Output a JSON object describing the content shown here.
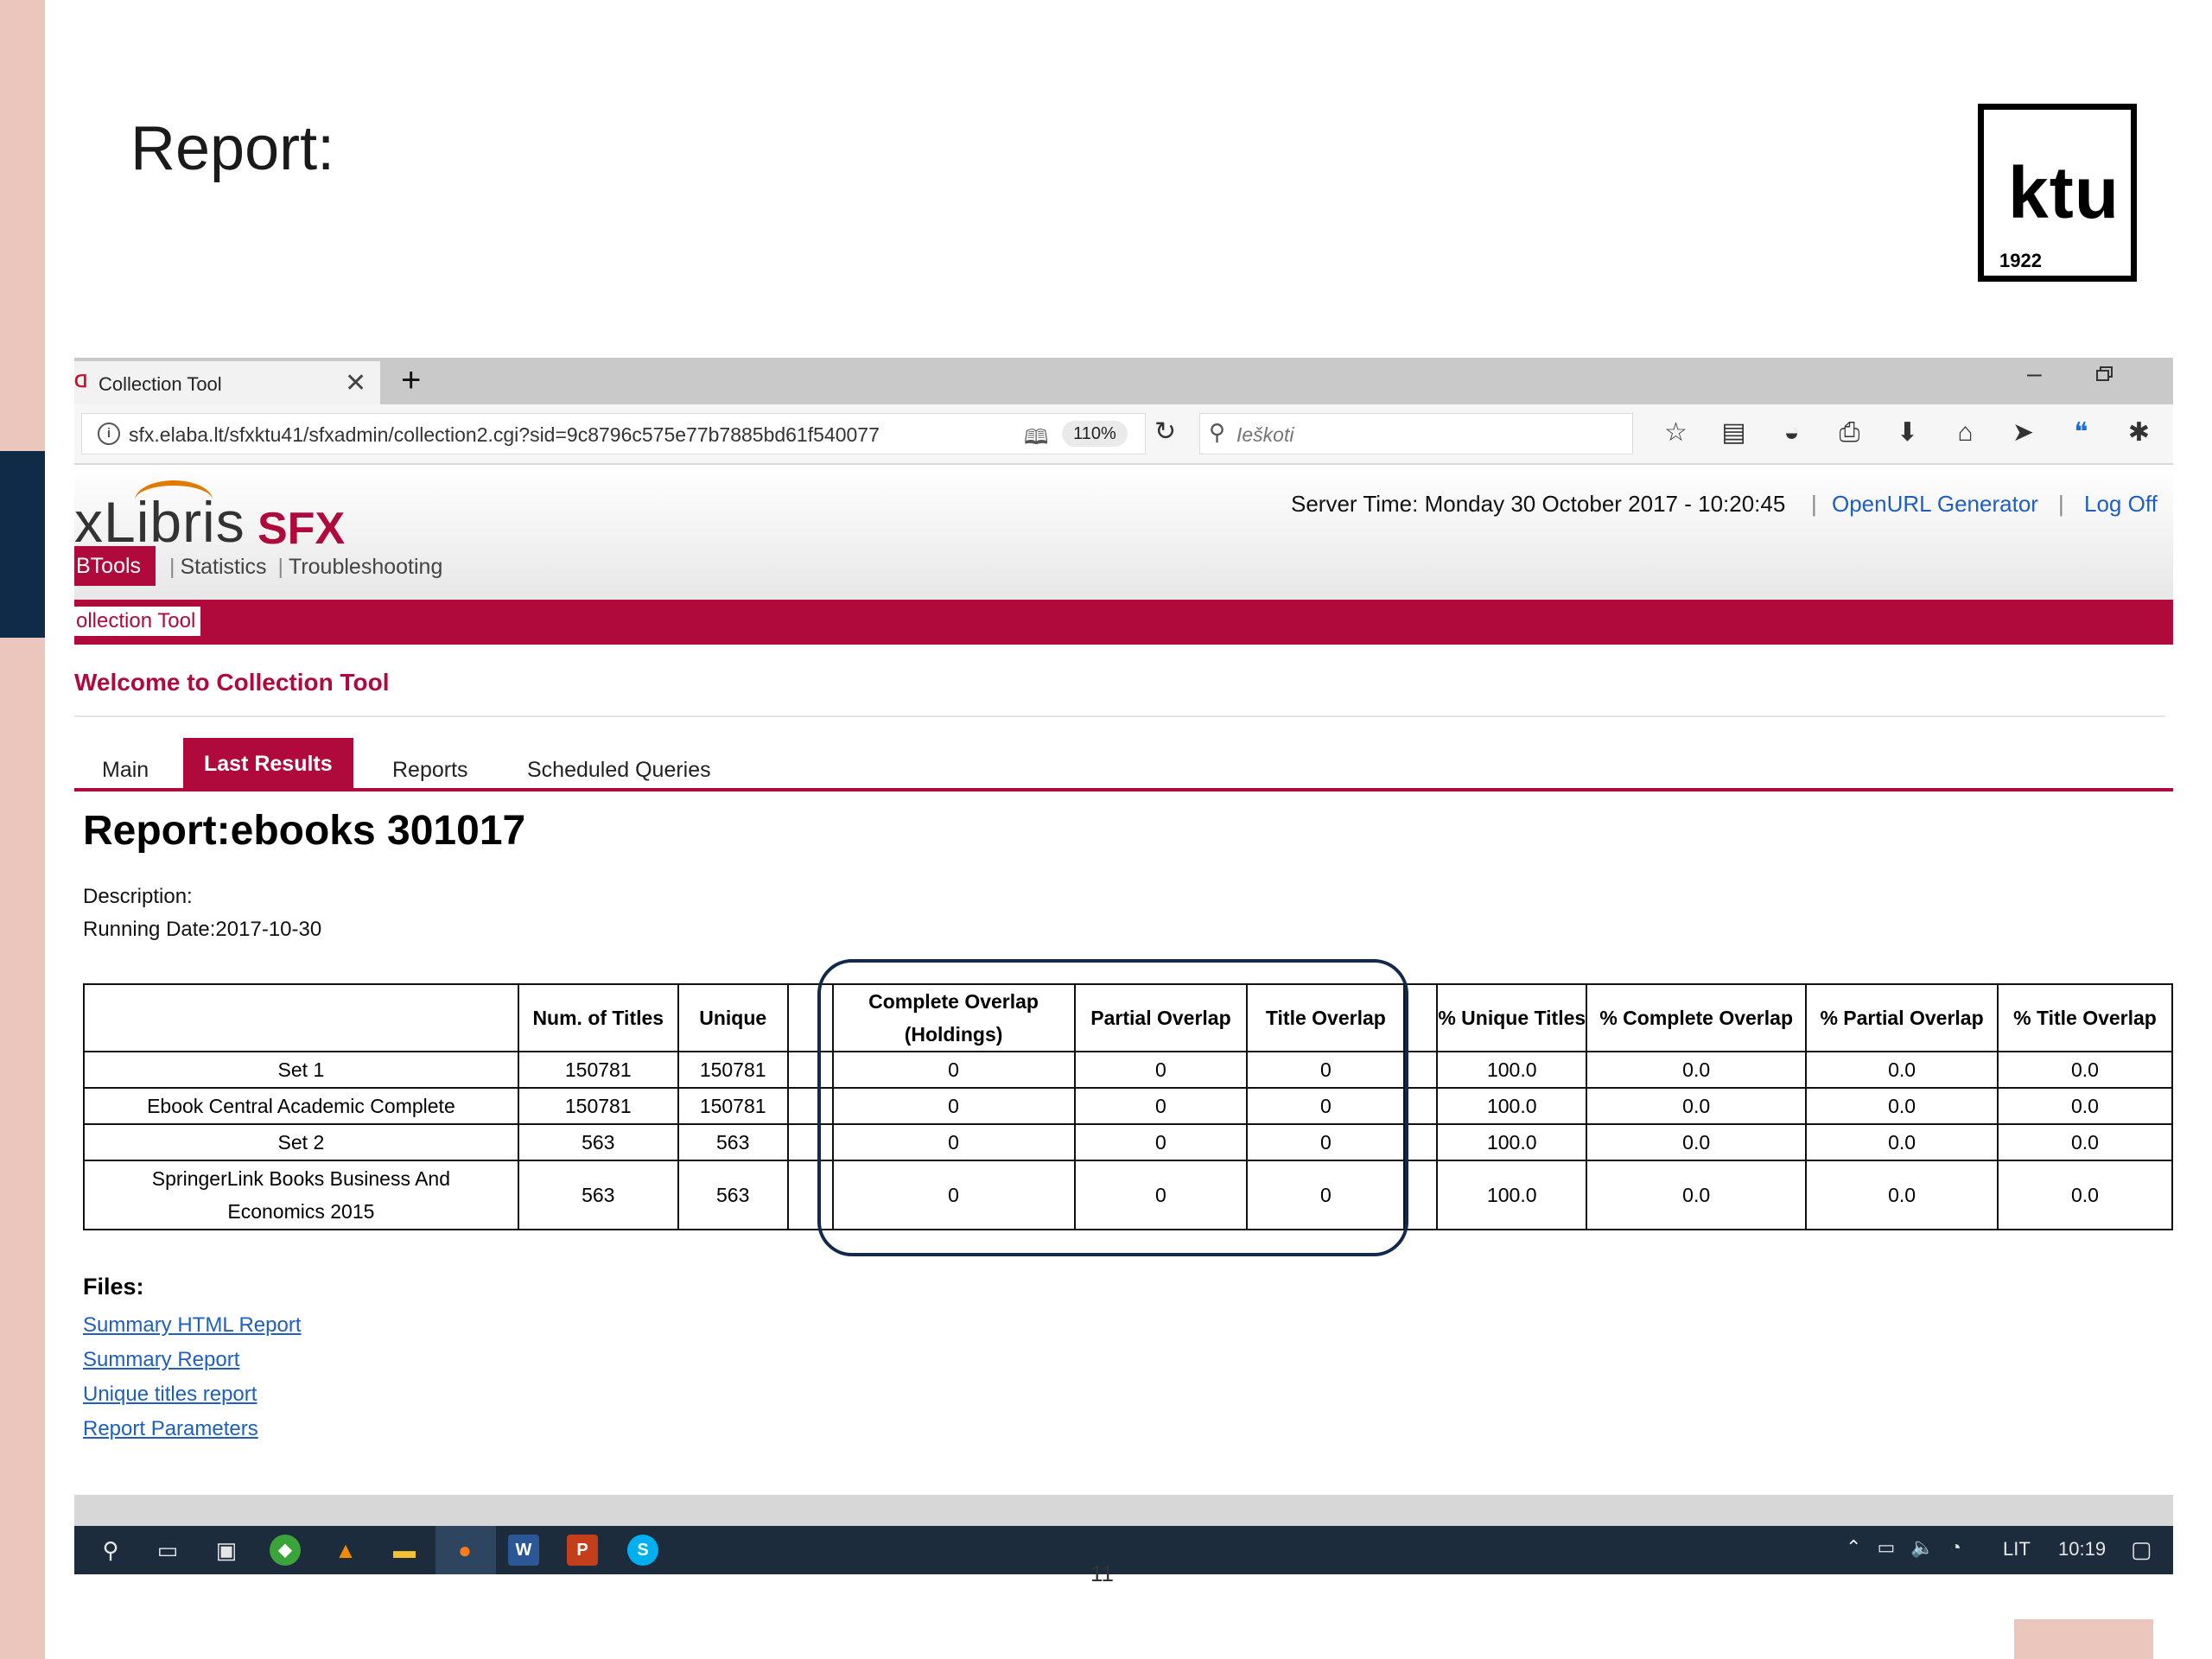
{
  "slide": {
    "title": "Report:",
    "logo_text": "ktu",
    "logo_year": "1922",
    "page_number": "11"
  },
  "browser": {
    "tab_title": "Collection Tool",
    "url": "sfx.elaba.lt/sfxktu41/sfxadmin/collection2.cgi?sid=9c8796c575e77b7885bd61f540077",
    "zoom": "110%",
    "search_placeholder": "Ieškoti"
  },
  "header": {
    "logo_main": "xLibris",
    "logo_product": "SFX",
    "server_time": "Server Time: Monday 30 October 2017 - 10:20:45",
    "openurl_link": "OpenURL Generator",
    "logoff_link": "Log Off",
    "menu_active": "BTools",
    "menu_items": [
      "Statistics",
      "Troubleshooting"
    ],
    "subtab": "ollection Tool"
  },
  "welcome": "Welcome to Collection Tool",
  "tabs": [
    "Main",
    "Last Results",
    "Reports",
    "Scheduled Queries"
  ],
  "report": {
    "title": "Report:ebooks 301017",
    "description": "Description:",
    "running_date": "Running Date:2017-10-30",
    "columns": [
      "",
      "Num. of Titles",
      "Unique",
      "",
      "Complete Overlap (Holdings)",
      "Partial Overlap",
      "Title Overlap",
      "",
      "% Unique Titles",
      "% Complete Overlap",
      "% Partial Overlap",
      "% Title Overlap"
    ],
    "rows": [
      [
        "Set 1",
        "150781",
        "150781",
        "",
        "0",
        "0",
        "0",
        "",
        "100.0",
        "0.0",
        "0.0",
        "0.0"
      ],
      [
        "Ebook Central Academic Complete",
        "150781",
        "150781",
        "",
        "0",
        "0",
        "0",
        "",
        "100.0",
        "0.0",
        "0.0",
        "0.0"
      ],
      [
        "Set 2",
        "563",
        "563",
        "",
        "0",
        "0",
        "0",
        "",
        "100.0",
        "0.0",
        "0.0",
        "0.0"
      ],
      [
        "SpringerLink Books Business And Economics 2015",
        "563",
        "563",
        "",
        "0",
        "0",
        "0",
        "",
        "100.0",
        "0.0",
        "0.0",
        "0.0"
      ]
    ]
  },
  "files": {
    "label": "Files:",
    "links": [
      "Summary HTML Report",
      "Summary Report",
      "Unique titles report",
      "Report Parameters"
    ]
  },
  "taskbar": {
    "lang": "LIT",
    "clock": "10:19"
  },
  "colors": {
    "brand": "#b0093c",
    "link": "#1e5fbf",
    "highlight_box": "#13294b",
    "slide_accent": "#ebc6bd",
    "slide_dark": "#0f2b48"
  }
}
